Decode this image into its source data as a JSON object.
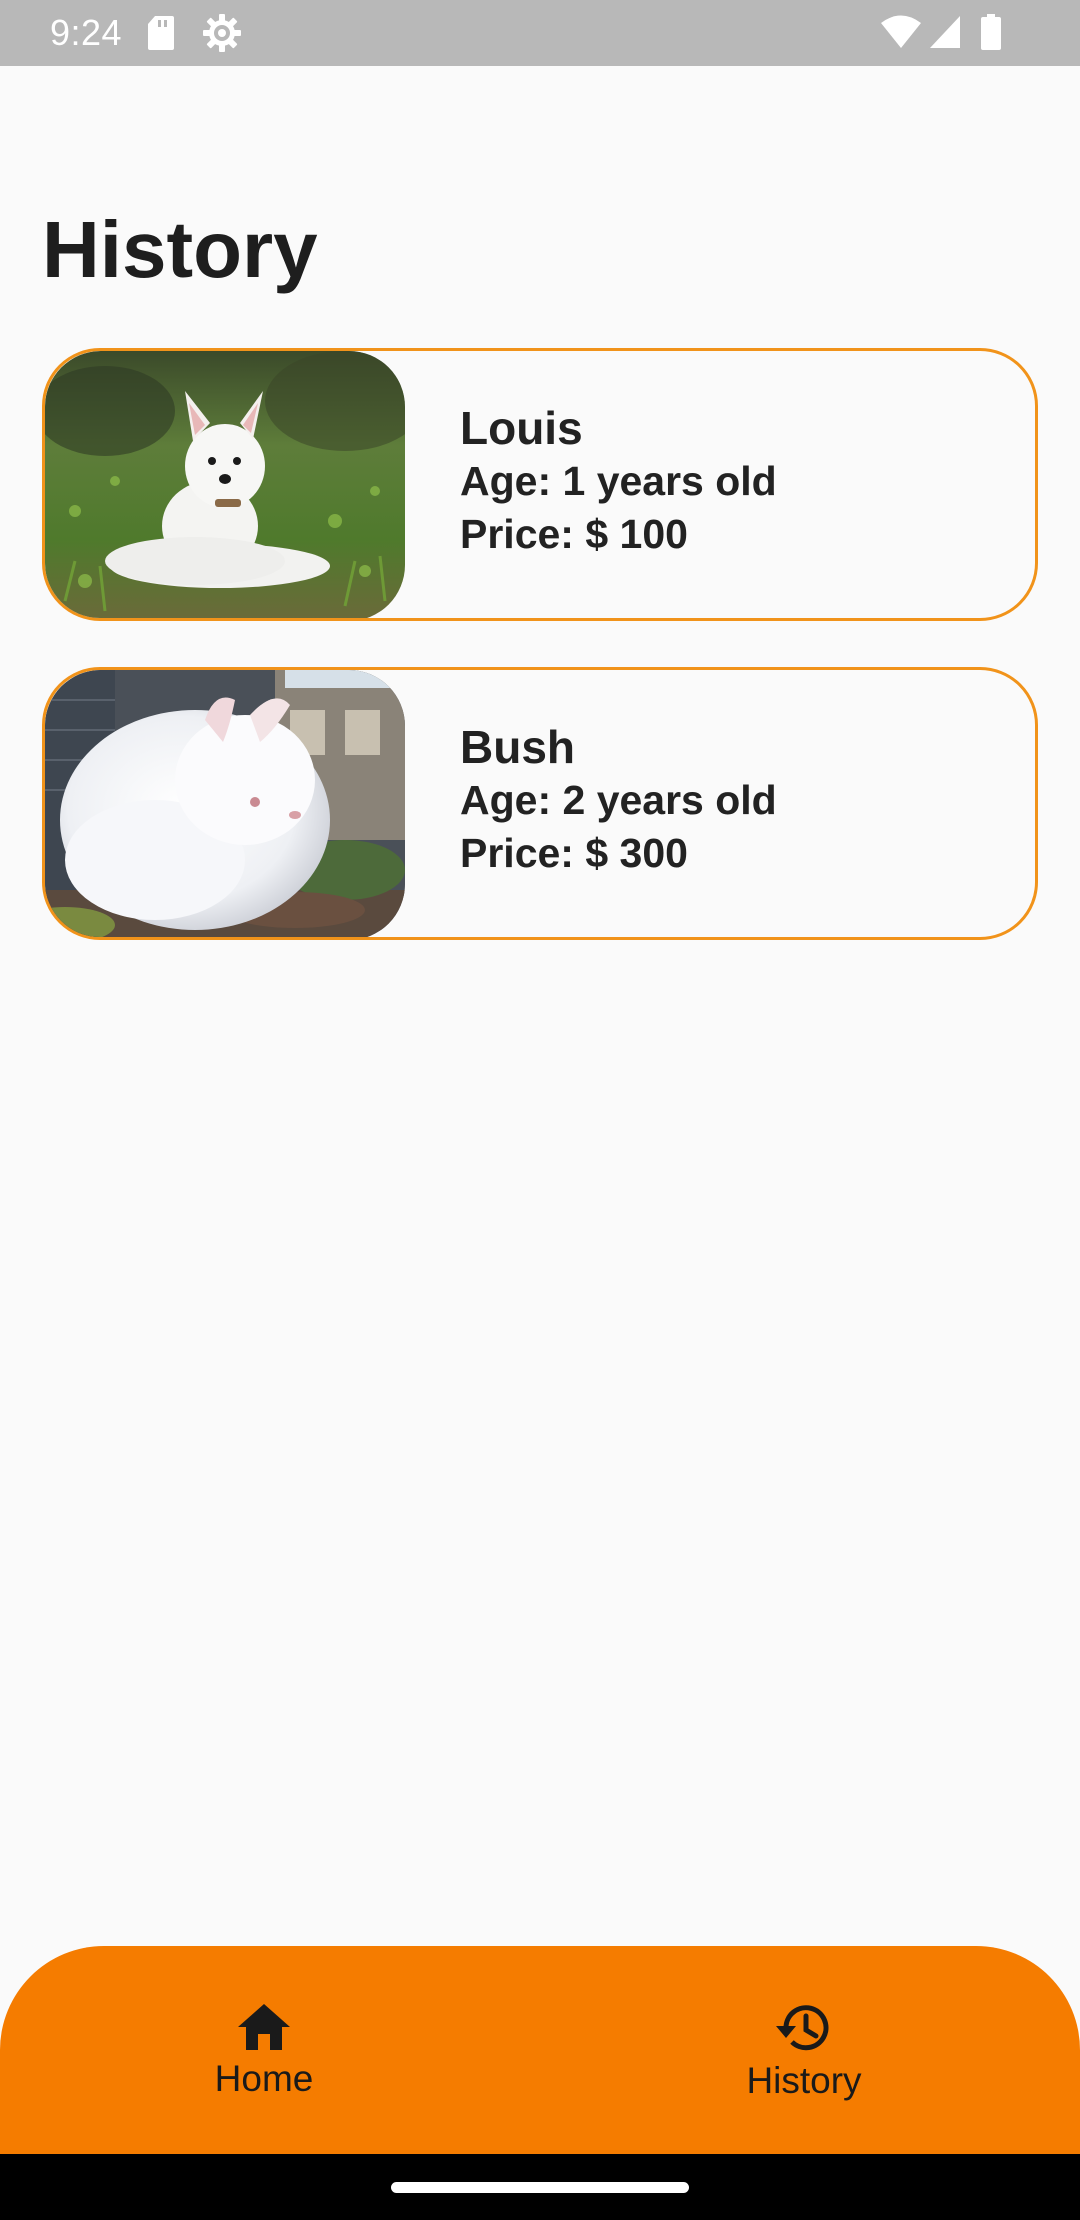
{
  "status_bar": {
    "time": "9:24",
    "icons_left": [
      "sd-card-icon",
      "settings-icon"
    ],
    "icons_right": [
      "wifi-icon",
      "signal-icon",
      "battery-icon"
    ]
  },
  "page": {
    "title": "History"
  },
  "history_items": [
    {
      "name": "Louis",
      "age": "Age: 1 years old",
      "price": "Price: $ 100",
      "photo": "dog-photo"
    },
    {
      "name": "Bush",
      "age": "Age: 2 years old",
      "price": "Price: $ 300",
      "photo": "rabbit-photo"
    }
  ],
  "bottom_nav": {
    "items": [
      {
        "label": "Home",
        "icon": "home-icon"
      },
      {
        "label": "History",
        "icon": "history-icon"
      }
    ]
  },
  "colors": {
    "accent": "#f57c00",
    "card_border": "#f1931a",
    "background": "#fafafa",
    "status_bar": "#b8b8b8",
    "text": "#222222"
  }
}
